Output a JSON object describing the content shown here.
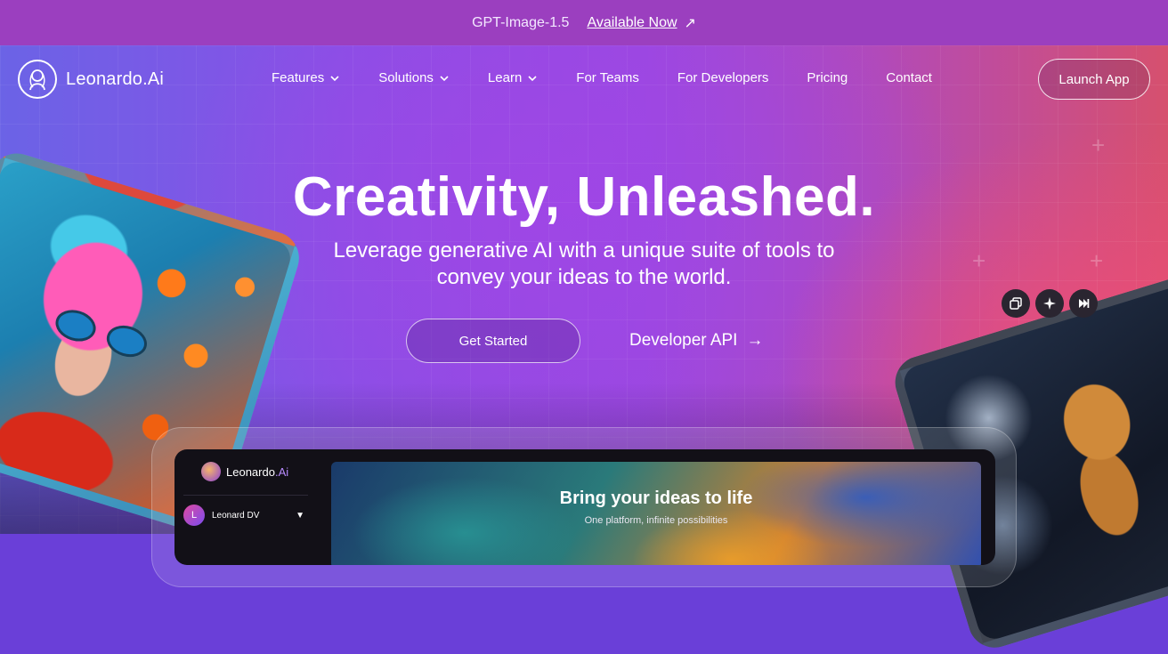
{
  "announcement": {
    "model": "GPT-Image-1.5",
    "link_label": "Available Now",
    "arrow": "↗"
  },
  "brand": {
    "name": "Leonardo.Ai"
  },
  "nav": {
    "items": [
      {
        "label": "Features",
        "dropdown": true
      },
      {
        "label": "Solutions",
        "dropdown": true
      },
      {
        "label": "Learn",
        "dropdown": true
      },
      {
        "label": "For Teams",
        "dropdown": false
      },
      {
        "label": "For Developers",
        "dropdown": false
      },
      {
        "label": "Pricing",
        "dropdown": false
      },
      {
        "label": "Contact",
        "dropdown": false
      }
    ],
    "launch_label": "Launch App"
  },
  "hero": {
    "headline": "Creativity, Unleashed.",
    "subheadline": "Leverage generative AI with a unique suite of tools to convey your ideas to the world.",
    "primary_cta": "Get Started",
    "secondary_cta": "Developer API",
    "secondary_arrow": "→"
  },
  "image_tools": [
    "copy-icon",
    "sparkle-icon",
    "skip-icon"
  ],
  "app_preview": {
    "logo_text": "Leonardo",
    "logo_suffix": ".Ai",
    "user_initial": "L",
    "user_name": "Leonard DV",
    "banner_title": "Bring your ideas to life",
    "banner_subtitle": "One platform, infinite possibilities"
  },
  "colors": {
    "announcement_bg": "#9b3fbf",
    "hero_left": "#6b63e6",
    "hero_right": "#d6506e",
    "app_dark": "#121017"
  }
}
